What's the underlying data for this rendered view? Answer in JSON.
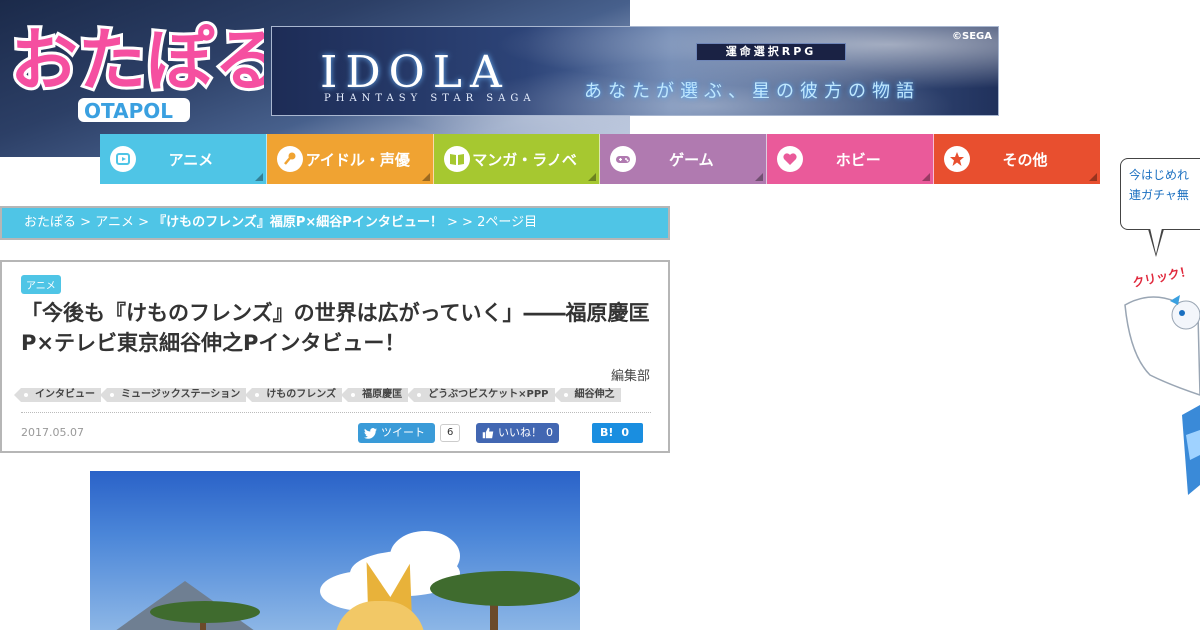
{
  "site": {
    "logo_text": "おたぽる",
    "logo_sub": "OTAPOL"
  },
  "ad_banner": {
    "title": "IDOLA",
    "subtitle": "PHANTASY STAR SAGA",
    "genre": "運命選択RPG",
    "tagline": "あなたが選ぶ、星の彼方の物語",
    "copyright": "©SEGA"
  },
  "nav": {
    "items": [
      {
        "label": "アニメ",
        "icon": "play-icon",
        "color": "#4fc5e6"
      },
      {
        "label": "アイドル・声優",
        "icon": "microphone-icon",
        "color": "#f0a332"
      },
      {
        "label": "マンガ・ラノベ",
        "icon": "book-icon",
        "color": "#a6c830"
      },
      {
        "label": "ゲーム",
        "icon": "gamepad-icon",
        "color": "#b07ab0"
      },
      {
        "label": "ホビー",
        "icon": "heart-icon",
        "color": "#ea5a9a"
      },
      {
        "label": "その他",
        "icon": "star-icon",
        "color": "#e84f2f"
      }
    ]
  },
  "breadcrumb": {
    "home": "おたぽる",
    "category": "アニメ",
    "article": "『けものフレンズ』福原P×細谷Pインタビュー！",
    "page": "2ページ目",
    "sep": ">"
  },
  "article": {
    "category": "アニメ",
    "title": "「今後も『けものフレンズ』の世界は広がっていく」――福原慶匡P×テレビ東京細谷伸之Pインタビュー！",
    "author": "編集部",
    "tags": [
      "インタビュー",
      "ミュージックステーション",
      "けものフレンズ",
      "福原慶匡",
      "どうぶつビスケット×PPP",
      "細谷伸之"
    ],
    "date": "2017.05.07"
  },
  "share": {
    "tweet_label": "ツイート",
    "tweet_count": "6",
    "like_label": "いいね！",
    "like_count": "0",
    "hatena_label": "B!",
    "hatena_count": "0"
  },
  "widget": {
    "line1": "今はじめれ",
    "line2": "連ガチャ無",
    "click_label": "クリック！"
  }
}
